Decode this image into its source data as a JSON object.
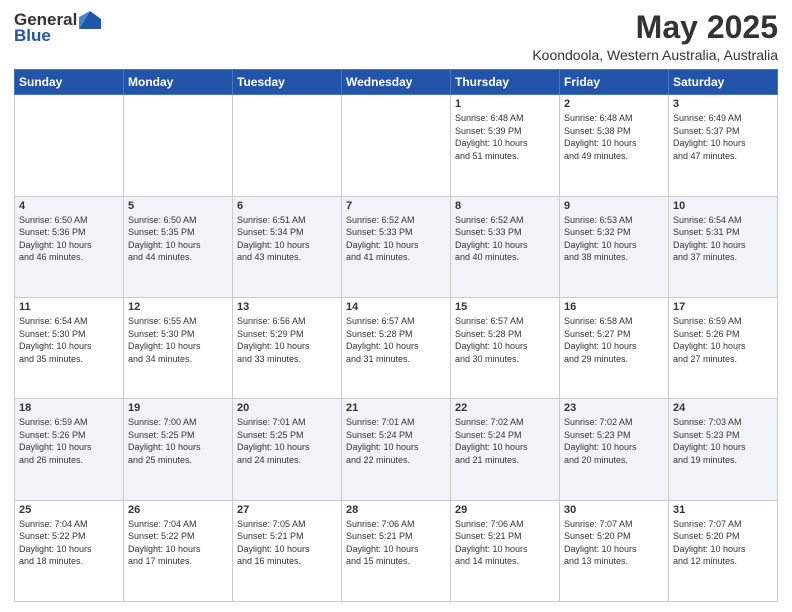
{
  "logo": {
    "general": "General",
    "blue": "Blue"
  },
  "title": {
    "month": "May 2025",
    "location": "Koondoola, Western Australia, Australia"
  },
  "weekdays": [
    "Sunday",
    "Monday",
    "Tuesday",
    "Wednesday",
    "Thursday",
    "Friday",
    "Saturday"
  ],
  "weeks": [
    [
      {
        "day": "",
        "info": ""
      },
      {
        "day": "",
        "info": ""
      },
      {
        "day": "",
        "info": ""
      },
      {
        "day": "",
        "info": ""
      },
      {
        "day": "1",
        "info": "Sunrise: 6:48 AM\nSunset: 5:39 PM\nDaylight: 10 hours\nand 51 minutes."
      },
      {
        "day": "2",
        "info": "Sunrise: 6:48 AM\nSunset: 5:38 PM\nDaylight: 10 hours\nand 49 minutes."
      },
      {
        "day": "3",
        "info": "Sunrise: 6:49 AM\nSunset: 5:37 PM\nDaylight: 10 hours\nand 47 minutes."
      }
    ],
    [
      {
        "day": "4",
        "info": "Sunrise: 6:50 AM\nSunset: 5:36 PM\nDaylight: 10 hours\nand 46 minutes."
      },
      {
        "day": "5",
        "info": "Sunrise: 6:50 AM\nSunset: 5:35 PM\nDaylight: 10 hours\nand 44 minutes."
      },
      {
        "day": "6",
        "info": "Sunrise: 6:51 AM\nSunset: 5:34 PM\nDaylight: 10 hours\nand 43 minutes."
      },
      {
        "day": "7",
        "info": "Sunrise: 6:52 AM\nSunset: 5:33 PM\nDaylight: 10 hours\nand 41 minutes."
      },
      {
        "day": "8",
        "info": "Sunrise: 6:52 AM\nSunset: 5:33 PM\nDaylight: 10 hours\nand 40 minutes."
      },
      {
        "day": "9",
        "info": "Sunrise: 6:53 AM\nSunset: 5:32 PM\nDaylight: 10 hours\nand 38 minutes."
      },
      {
        "day": "10",
        "info": "Sunrise: 6:54 AM\nSunset: 5:31 PM\nDaylight: 10 hours\nand 37 minutes."
      }
    ],
    [
      {
        "day": "11",
        "info": "Sunrise: 6:54 AM\nSunset: 5:30 PM\nDaylight: 10 hours\nand 35 minutes."
      },
      {
        "day": "12",
        "info": "Sunrise: 6:55 AM\nSunset: 5:30 PM\nDaylight: 10 hours\nand 34 minutes."
      },
      {
        "day": "13",
        "info": "Sunrise: 6:56 AM\nSunset: 5:29 PM\nDaylight: 10 hours\nand 33 minutes."
      },
      {
        "day": "14",
        "info": "Sunrise: 6:57 AM\nSunset: 5:28 PM\nDaylight: 10 hours\nand 31 minutes."
      },
      {
        "day": "15",
        "info": "Sunrise: 6:57 AM\nSunset: 5:28 PM\nDaylight: 10 hours\nand 30 minutes."
      },
      {
        "day": "16",
        "info": "Sunrise: 6:58 AM\nSunset: 5:27 PM\nDaylight: 10 hours\nand 29 minutes."
      },
      {
        "day": "17",
        "info": "Sunrise: 6:59 AM\nSunset: 5:26 PM\nDaylight: 10 hours\nand 27 minutes."
      }
    ],
    [
      {
        "day": "18",
        "info": "Sunrise: 6:59 AM\nSunset: 5:26 PM\nDaylight: 10 hours\nand 26 minutes."
      },
      {
        "day": "19",
        "info": "Sunrise: 7:00 AM\nSunset: 5:25 PM\nDaylight: 10 hours\nand 25 minutes."
      },
      {
        "day": "20",
        "info": "Sunrise: 7:01 AM\nSunset: 5:25 PM\nDaylight: 10 hours\nand 24 minutes."
      },
      {
        "day": "21",
        "info": "Sunrise: 7:01 AM\nSunset: 5:24 PM\nDaylight: 10 hours\nand 22 minutes."
      },
      {
        "day": "22",
        "info": "Sunrise: 7:02 AM\nSunset: 5:24 PM\nDaylight: 10 hours\nand 21 minutes."
      },
      {
        "day": "23",
        "info": "Sunrise: 7:02 AM\nSunset: 5:23 PM\nDaylight: 10 hours\nand 20 minutes."
      },
      {
        "day": "24",
        "info": "Sunrise: 7:03 AM\nSunset: 5:23 PM\nDaylight: 10 hours\nand 19 minutes."
      }
    ],
    [
      {
        "day": "25",
        "info": "Sunrise: 7:04 AM\nSunset: 5:22 PM\nDaylight: 10 hours\nand 18 minutes."
      },
      {
        "day": "26",
        "info": "Sunrise: 7:04 AM\nSunset: 5:22 PM\nDaylight: 10 hours\nand 17 minutes."
      },
      {
        "day": "27",
        "info": "Sunrise: 7:05 AM\nSunset: 5:21 PM\nDaylight: 10 hours\nand 16 minutes."
      },
      {
        "day": "28",
        "info": "Sunrise: 7:06 AM\nSunset: 5:21 PM\nDaylight: 10 hours\nand 15 minutes."
      },
      {
        "day": "29",
        "info": "Sunrise: 7:06 AM\nSunset: 5:21 PM\nDaylight: 10 hours\nand 14 minutes."
      },
      {
        "day": "30",
        "info": "Sunrise: 7:07 AM\nSunset: 5:20 PM\nDaylight: 10 hours\nand 13 minutes."
      },
      {
        "day": "31",
        "info": "Sunrise: 7:07 AM\nSunset: 5:20 PM\nDaylight: 10 hours\nand 12 minutes."
      }
    ]
  ]
}
